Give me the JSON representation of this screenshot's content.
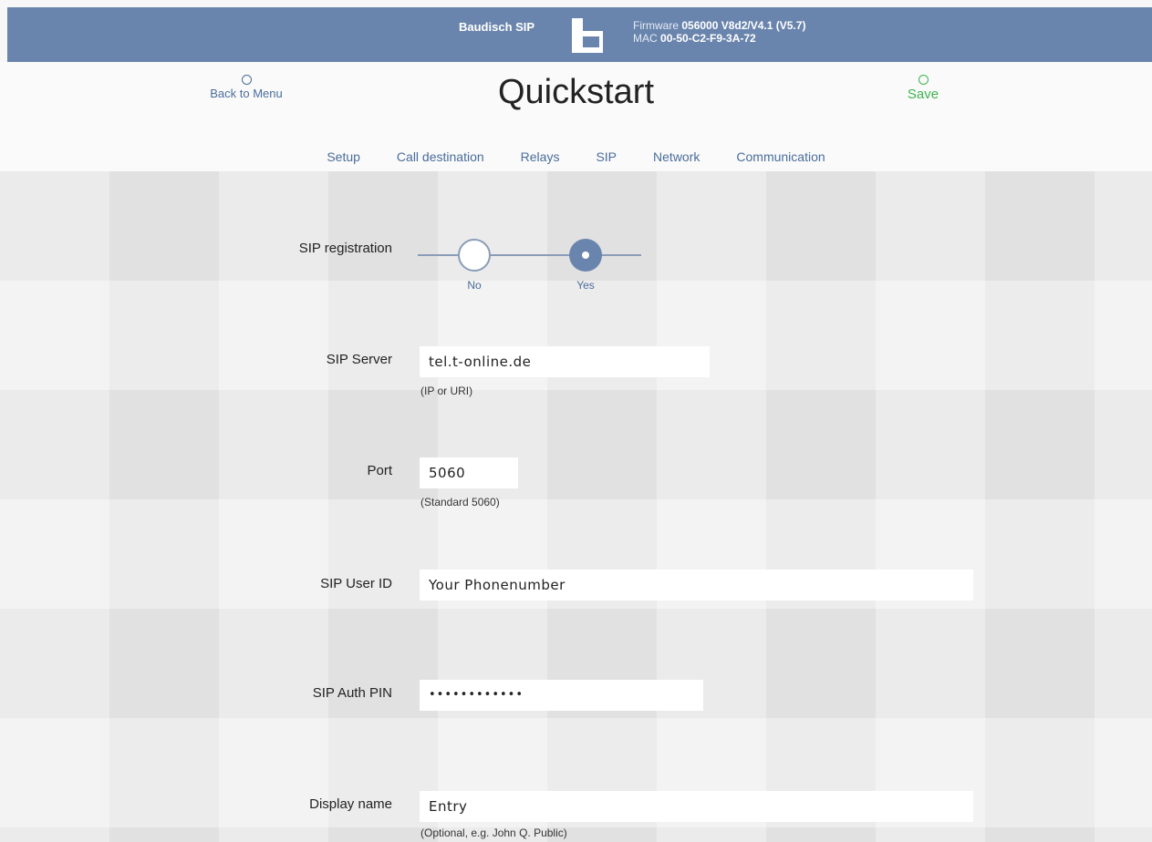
{
  "header": {
    "device": "Baudisch SIP",
    "firmware_label": "Firmware",
    "firmware_value": "056000 V8d2/V4.1 (V5.7)",
    "mac_label": "MAC",
    "mac_value": "00-50-C2-F9-3A-72",
    "logo_icon": "baudisch-logo-icon"
  },
  "nav": {
    "back_label": "Back to Menu",
    "title": "Quickstart",
    "save_label": "Save"
  },
  "tabs": [
    {
      "label": "Setup"
    },
    {
      "label": "Call destination"
    },
    {
      "label": "Relays"
    },
    {
      "label": "SIP"
    },
    {
      "label": "Network"
    },
    {
      "label": "Communication"
    }
  ],
  "active_tab": "SIP",
  "form": {
    "registration": {
      "label": "SIP registration",
      "no_label": "No",
      "yes_label": "Yes",
      "selected": "Yes"
    },
    "server": {
      "label": "SIP Server",
      "value": "tel.t-online.de",
      "hint": "(IP or URI)"
    },
    "port": {
      "label": "Port",
      "value": "5060",
      "hint": "(Standard 5060)"
    },
    "user_id": {
      "label": "SIP User ID",
      "value": "Your Phonenumber"
    },
    "auth_pin": {
      "label": "SIP Auth PIN",
      "value": "••••••••••••"
    },
    "display_name": {
      "label": "Display name",
      "value": "Entry",
      "hint": "(Optional, e.g. John Q. Public)"
    }
  },
  "colors": {
    "header_bg": "#6a85ad",
    "link": "#4a6d9c",
    "save": "#3fb34f"
  }
}
